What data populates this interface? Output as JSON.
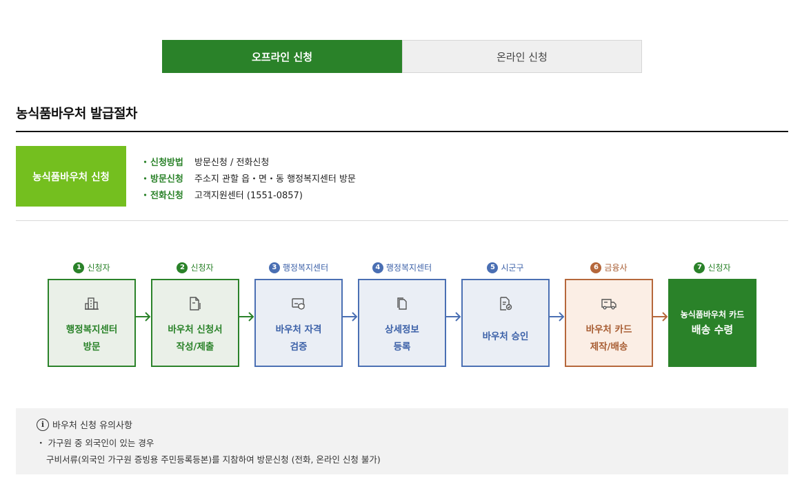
{
  "tabs": [
    {
      "label": "오프라인 신청",
      "active": true
    },
    {
      "label": "온라인 신청",
      "active": false
    }
  ],
  "section_title": "농식품바우처 발급절차",
  "apply_box": "농식품바우처 신청",
  "info_rows": [
    {
      "label": "신청방법",
      "value": "방문신청 / 전화신청"
    },
    {
      "label": "방문신청",
      "value": "주소지 관할 읍・면・동 행정복지센터 방문"
    },
    {
      "label": "전화신청",
      "value": "고객지원센터 (1551-0857)"
    }
  ],
  "steps": [
    {
      "num": "1",
      "actor": "신청자",
      "line1": "행정복지센터",
      "line2": "방문",
      "icon": "building-icon",
      "tone": "green"
    },
    {
      "num": "2",
      "actor": "신청자",
      "line1": "바우처 신청서",
      "line2": "작성/제출",
      "icon": "document-pen-icon",
      "tone": "green"
    },
    {
      "num": "3",
      "actor": "행정복지센터",
      "line1": "바우처 자격",
      "line2": "검증",
      "icon": "card-shield-icon",
      "tone": "blue"
    },
    {
      "num": "4",
      "actor": "행정복지센터",
      "line1": "상세정보",
      "line2": "등록",
      "icon": "copy-document-icon",
      "tone": "blue"
    },
    {
      "num": "5",
      "actor": "시군구",
      "line1": "바우처 승인",
      "line2": "",
      "icon": "document-check-icon",
      "tone": "blue"
    },
    {
      "num": "6",
      "actor": "금융사",
      "line1": "바우처 카드",
      "line2": "제작/배송",
      "icon": "delivery-truck-icon",
      "tone": "orange"
    },
    {
      "num": "7",
      "actor": "신청자",
      "line1": "농식품바우처 카드",
      "line2": "배송 수령",
      "icon": "",
      "tone": "final"
    }
  ],
  "colors": {
    "green": "#2a8229",
    "light_green": "#74bf1f",
    "blue": "#4a6fb3",
    "orange": "#b5673b"
  },
  "notice": {
    "title": "바우처 신청 유의사항",
    "bullet": "・ 가구원 중 외국인이 있는 경우",
    "detail": "구비서류(외국인 가구원 증빙용 주민등록등본)를 지참하여 방문신청 (전화, 온라인 신청 불가)"
  }
}
